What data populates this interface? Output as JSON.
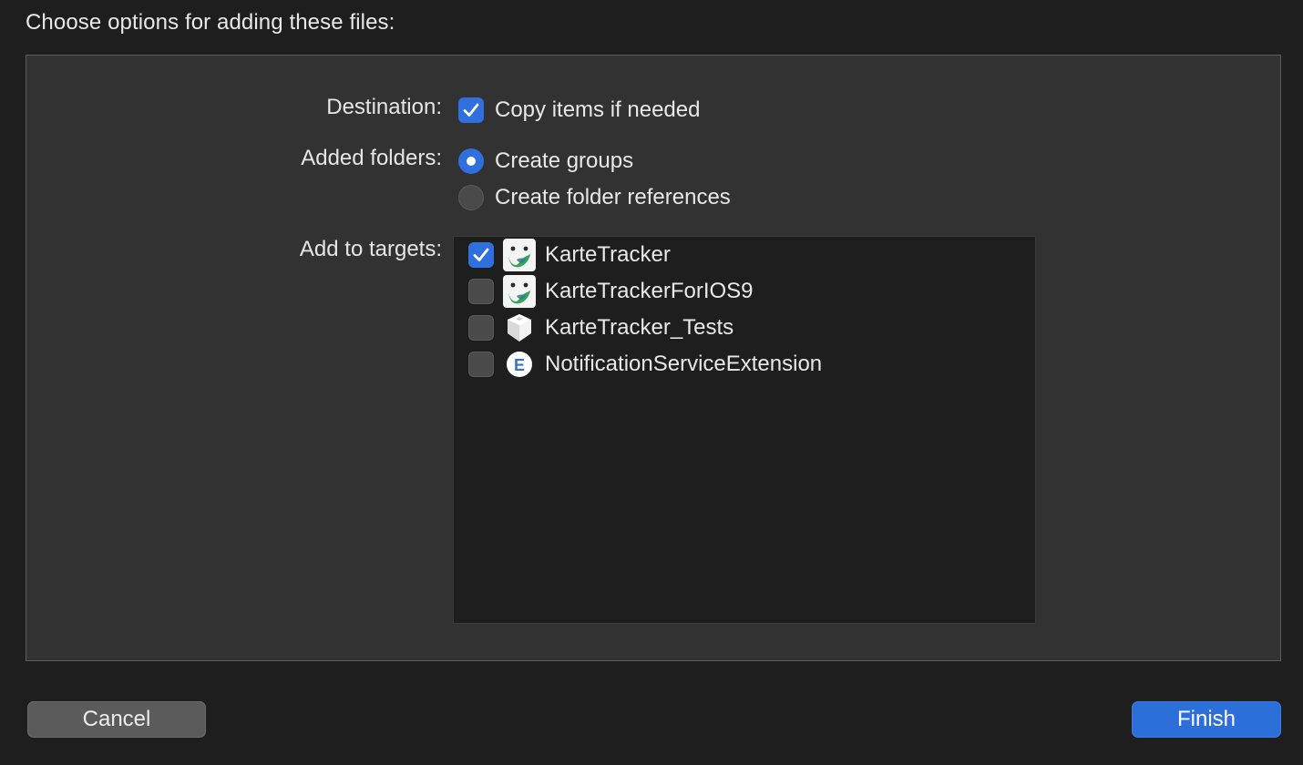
{
  "dialog": {
    "title": "Choose options for adding these files:"
  },
  "destination": {
    "label": "Destination:",
    "copy_items": {
      "text": "Copy items if needed",
      "checked": true
    }
  },
  "added_folders": {
    "label": "Added folders:",
    "options": [
      {
        "text": "Create groups",
        "selected": true
      },
      {
        "text": "Create folder references",
        "selected": false
      }
    ]
  },
  "targets": {
    "label": "Add to targets:",
    "items": [
      {
        "name": "KarteTracker",
        "checked": true,
        "icon": "karte-app-icon"
      },
      {
        "name": "KarteTrackerForIOS9",
        "checked": false,
        "icon": "karte-app-icon"
      },
      {
        "name": "KarteTracker_Tests",
        "checked": false,
        "icon": "test-bundle-icon"
      },
      {
        "name": "NotificationServiceExtension",
        "checked": false,
        "icon": "extension-icon"
      }
    ]
  },
  "buttons": {
    "cancel": "Cancel",
    "finish": "Finish"
  },
  "colors": {
    "accent": "#2f6fde",
    "background": "#1e1e1e",
    "panel": "#323232"
  }
}
